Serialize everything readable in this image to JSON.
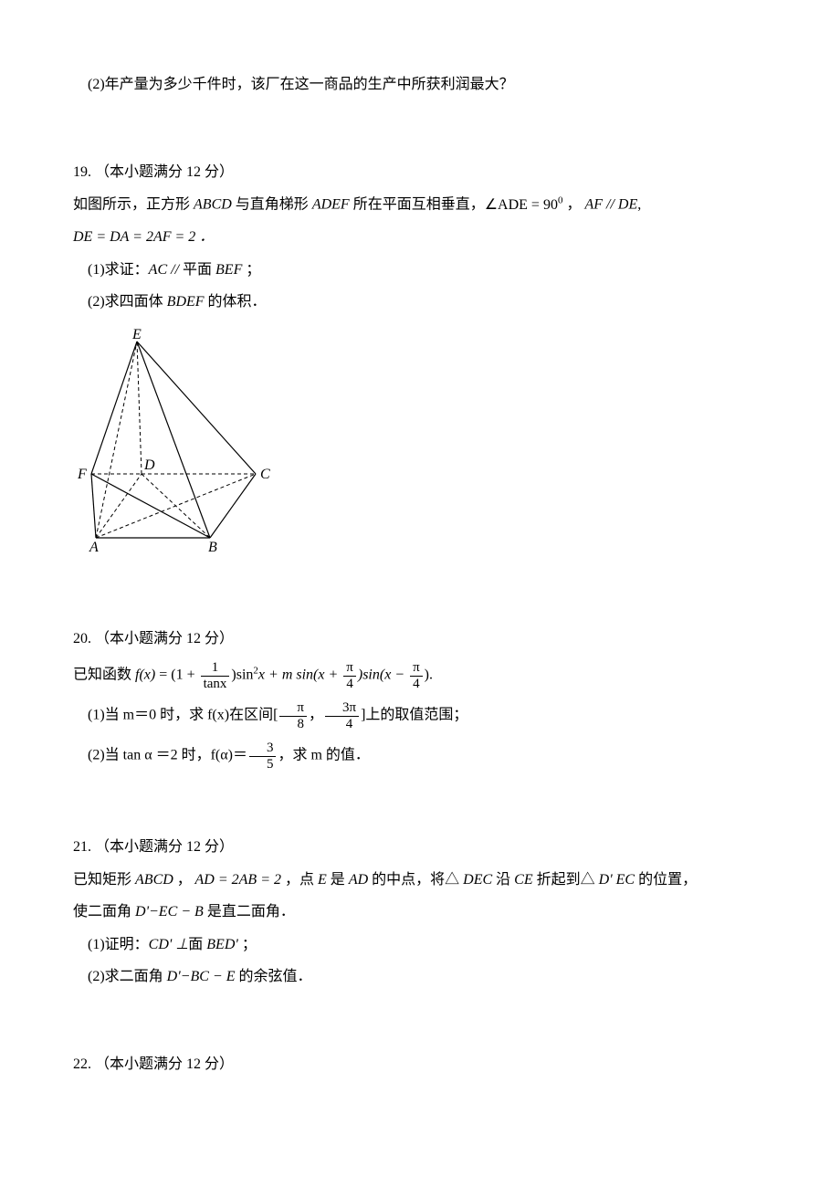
{
  "q18_sub2": "(2)年产量为多少千件时，该厂在这一商品的生产中所获利润最大？",
  "q19": {
    "header": "19. （本小题满分 12 分）",
    "body_pre": "如图所示，正方形",
    "abcd": " ABCD ",
    "body_mid1": "与直角梯形",
    "adef": " ADEF ",
    "body_mid2": "所在平面互相垂直，",
    "angle": "∠ADE = 90",
    "deg": "0",
    "comma": " ， ",
    "parallel": "AF // DE",
    "line2": "DE = DA = 2AF = 2 ．",
    "sub1_pre": "(1)求证：",
    "sub1_mid": "AC // ",
    "sub1_plane": "平面 ",
    "sub1_bef": "BEF",
    "sub1_end": " ；",
    "sub2_pre": "(2)求四面体 ",
    "sub2_bdef": "BDEF",
    "sub2_end": " 的体积．"
  },
  "fig": {
    "E": "E",
    "F": "F",
    "D": "D",
    "C": "C",
    "A": "A",
    "B": "B"
  },
  "q20": {
    "header": "20. （本小题满分 12 分）",
    "intro": "已知函数 ",
    "fx": "f(x)",
    "eq": " = (1 + ",
    "frac1_num": "1",
    "frac1_den": "tanx",
    "mid1": ")sin",
    "sq": "2",
    "mid2": "x + m sin(x + ",
    "fracpi4_num": "π",
    "fracpi4_den": "4",
    "mid3": ")sin(x − ",
    "end": ").",
    "sub1_pre": "(1)当 m＝0 时，求 f(x)在区间[",
    "sub1_f2_num": "π",
    "sub1_f2_den": "8",
    "sub1_comma": "，",
    "sub1_f3_num": "3π",
    "sub1_f3_den": "4",
    "sub1_end": "]上的取值范围；",
    "sub2_pre": "(2)当 tan α ＝2 时，f(α)＝",
    "sub2_f_num": "3",
    "sub2_f_den": "5",
    "sub2_end": "，求 m 的值．"
  },
  "q21": {
    "header": "21. （本小题满分 12 分）",
    "l1_pre": "已知矩形",
    "abcd": " ABCD ",
    "comma1": "，",
    "eq": " AD = 2AB = 2 ",
    "comma2": "，点",
    "E": " E ",
    "mid1": "是",
    "AD": " AD ",
    "mid2": "的中点，将△",
    "DEC": " DEC ",
    "mid3": "沿",
    "CE": " CE ",
    "mid4": "折起到△",
    "DpEC": " D' EC ",
    "mid5": "的位置，",
    "l2_pre": "使二面角",
    "dih1": " D'−EC − B ",
    "l2_end": "是直二面角．",
    "sub1_pre": "(1)证明：",
    "sub1_mid": "CD' ⊥",
    "sub1_plane": "面 ",
    "sub1_bed": "BED'",
    "sub1_end": " ；",
    "sub2_pre": "(2)求二面角",
    "dih2": " D'−BC − E ",
    "sub2_end": "的余弦值．"
  },
  "q22": {
    "header": "22. （本小题满分 12 分）"
  }
}
